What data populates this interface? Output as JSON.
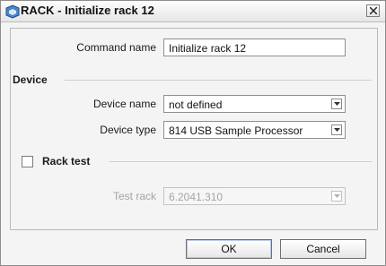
{
  "window": {
    "title": "RACK - Initialize rack 12",
    "close_label": "×"
  },
  "form": {
    "command_name_label": "Command name",
    "command_name_value": "Initialize rack 12"
  },
  "device": {
    "section_label": "Device",
    "device_name_label": "Device name",
    "device_name_value": "not defined",
    "device_type_label": "Device type",
    "device_type_value": "814 USB Sample Processor"
  },
  "rack_test": {
    "checkbox_label": "Rack test",
    "checked": false,
    "test_rack_label": "Test rack",
    "test_rack_value": "6.2041.310"
  },
  "buttons": {
    "ok_label": "OK",
    "cancel_label": "Cancel"
  },
  "colors": {
    "accent": "#2f5fa8"
  },
  "icons": {
    "app": "rack-app-icon",
    "close": "close-icon",
    "dropdown": "chevron-down-icon"
  }
}
